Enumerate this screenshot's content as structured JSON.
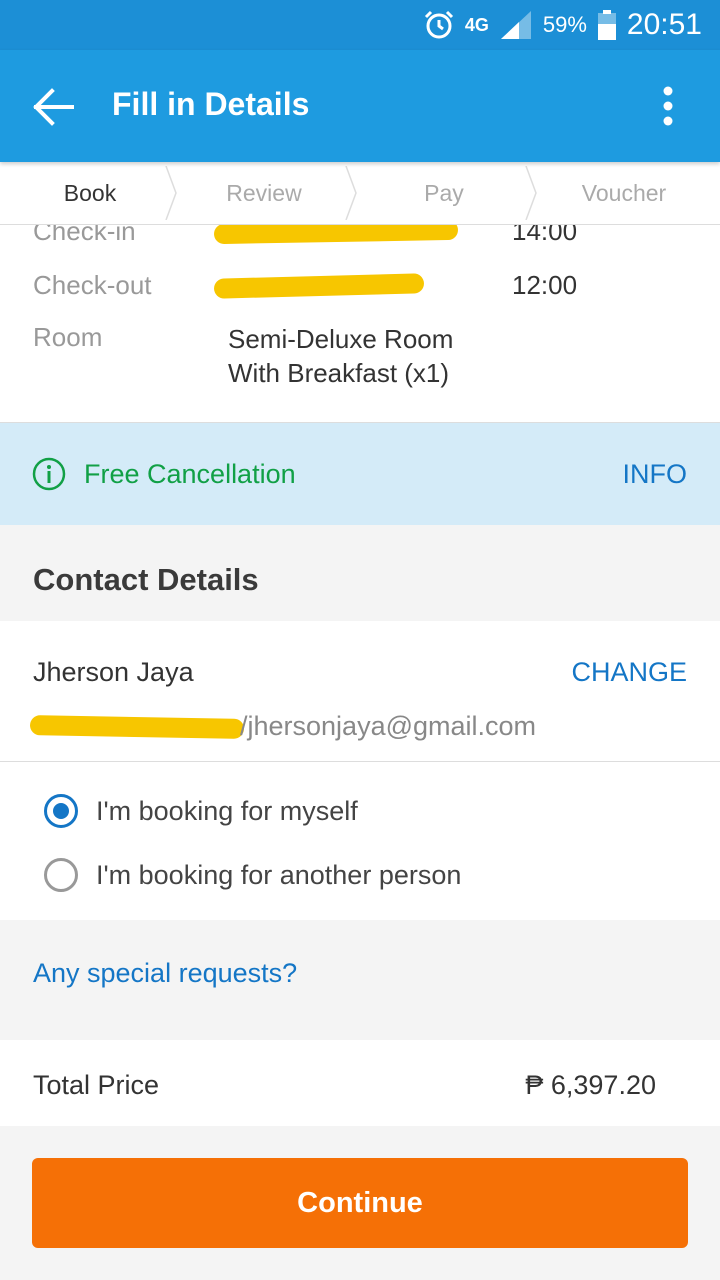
{
  "status_bar": {
    "network": "4G",
    "battery": "59%",
    "time": "20:51"
  },
  "header": {
    "title": "Fill in Details"
  },
  "steps": [
    {
      "label": "Book"
    },
    {
      "label": "Review"
    },
    {
      "label": "Pay"
    },
    {
      "label": "Voucher"
    }
  ],
  "booking": {
    "checkin_label": "Check-in",
    "checkin_time": "14:00",
    "checkout_label": "Check-out",
    "checkout_time": "12:00",
    "room_label": "Room",
    "room_line1": "Semi-Deluxe Room",
    "room_line2": "With Breakfast (x1)"
  },
  "notice": {
    "text": "Free Cancellation",
    "info_label": "INFO"
  },
  "contact": {
    "section_title": "Contact Details",
    "name": "Jherson Jaya",
    "change_label": "CHANGE",
    "email": "/jhersonjaya@gmail.com"
  },
  "booking_for": {
    "option_self": "I'm booking for myself",
    "option_other": "I'm booking for another person"
  },
  "special_requests": "Any special requests?",
  "price": {
    "label": "Total Price",
    "amount": "₱  6,397.20"
  },
  "continue_label": "Continue",
  "colors": {
    "appbar": "#1e9be0",
    "accent_blue": "#1476c6",
    "success_green": "#11a046",
    "cta_orange": "#f57006",
    "redaction": "#f7c600"
  }
}
